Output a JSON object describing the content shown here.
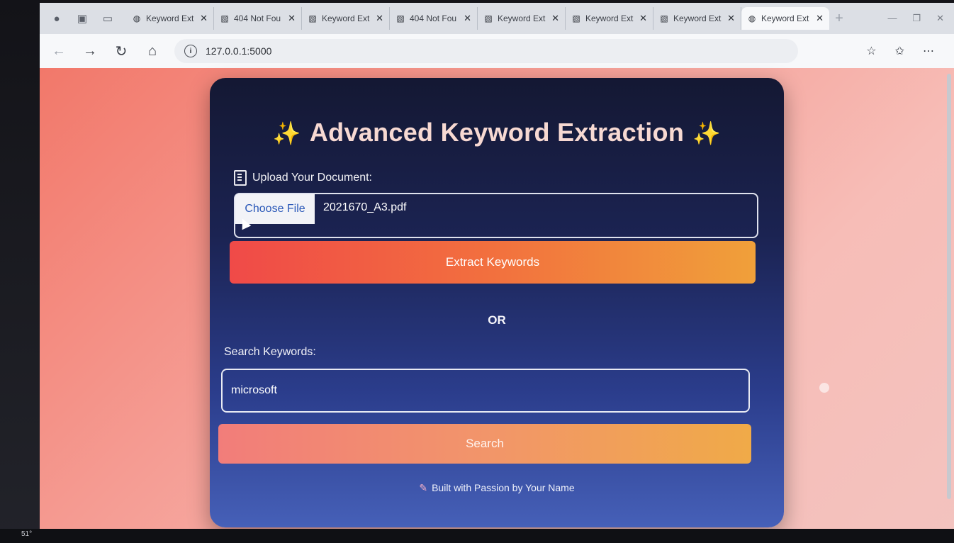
{
  "browser": {
    "tabs": [
      {
        "label": "Keyword Ext",
        "icon": "globe-icon",
        "active": false
      },
      {
        "label": "404 Not Fou",
        "icon": "image-icon",
        "active": false
      },
      {
        "label": "Keyword Ext",
        "icon": "image-icon",
        "active": false
      },
      {
        "label": "404 Not Fou",
        "icon": "image-icon",
        "active": false
      },
      {
        "label": "Keyword Ext",
        "icon": "image-icon",
        "active": false
      },
      {
        "label": "Keyword Ext",
        "icon": "image-icon",
        "active": false
      },
      {
        "label": "Keyword Ext",
        "icon": "image-icon",
        "active": false
      },
      {
        "label": "Keyword Ext",
        "icon": "globe-icon",
        "active": true
      }
    ],
    "url": "127.0.0.1:5000"
  },
  "page": {
    "title": "Advanced Keyword Extraction",
    "upload_label": "Upload Your Document:",
    "file_button": "Choose File",
    "file_name": "2021670_A3.pdf",
    "extract_button": "Extract Keywords",
    "or_text": "OR",
    "search_label": "Search Keywords:",
    "search_value": "microsoft",
    "search_button": "Search",
    "footer": "Built with Passion by Your Name"
  },
  "taskbar": {
    "temperature": "51°"
  },
  "colors": {
    "card_top": "#141833",
    "card_bottom": "#4660b8",
    "extract_gradient_start": "#f04a48",
    "extract_gradient_end": "#f0a03a",
    "title_color": "#f7d9d2",
    "sparkle": "#f5c84a"
  }
}
